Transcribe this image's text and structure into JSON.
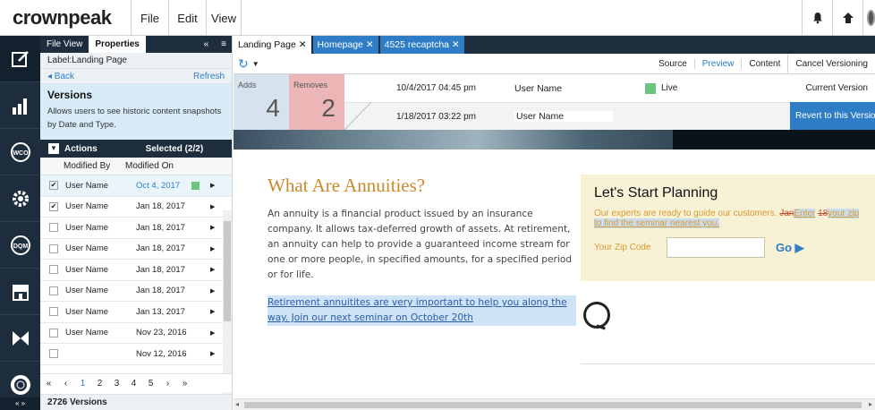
{
  "app": {
    "logo": "crownpeak"
  },
  "menu": {
    "file": "File",
    "edit": "Edit",
    "view": "View"
  },
  "panel": {
    "tab_file_view": "File View",
    "tab_properties": "Properties",
    "label": "Label:Landing Page",
    "back": "◂ Back",
    "refresh": "Refresh",
    "versions_title": "Versions",
    "versions_desc": "Allows users to see historic content snapshots by Date and Type.",
    "actions": "Actions",
    "selected": "Selected (2/2)",
    "col_modified_by": "Modified By",
    "col_modified_on": "Modified On",
    "rows": [
      {
        "user": "User Name",
        "date": "Oct 4, 2017",
        "checked": true
      },
      {
        "user": "User Name",
        "date": "Jan 18, 2017",
        "checked": true
      },
      {
        "user": "User Name",
        "date": "Jan 18, 2017",
        "checked": false
      },
      {
        "user": "User Name",
        "date": "Jan 18, 2017",
        "checked": false
      },
      {
        "user": "User Name",
        "date": "Jan 18, 2017",
        "checked": false
      },
      {
        "user": "User Name",
        "date": "Jan 18, 2017",
        "checked": false
      },
      {
        "user": "User Name",
        "date": "Jan 13, 2017",
        "checked": false
      },
      {
        "user": "User Name",
        "date": "Nov 23, 2016",
        "checked": false
      },
      {
        "user": "",
        "date": "Nov 12, 2016",
        "checked": false
      }
    ],
    "pager": {
      "first": "«",
      "prev": "‹",
      "pages": [
        "1",
        "2",
        "3",
        "4",
        "5"
      ],
      "next": "›",
      "last": "»"
    },
    "footer": "2726 Versions"
  },
  "tabs": [
    {
      "label": "Landing Page ✕"
    },
    {
      "label": "Homepage ✕"
    },
    {
      "label": "4525 recaptcha ✕"
    }
  ],
  "toolbar": {
    "source": "Source",
    "preview": "Preview",
    "content": "Content",
    "cancel": "Cancel Versioning"
  },
  "compare": {
    "adds_label": "Adds",
    "adds_count": "4",
    "removes_label": "Removes",
    "removes_count": "2",
    "v1_time": "10/4/2017 04:45 pm",
    "v1_user": "User Name",
    "v1_status": "Live",
    "v1_current": "Current Version",
    "v2_time": "1/18/2017 03:22 pm",
    "v2_user": "User Name",
    "revert": "Revert to this Version"
  },
  "preview": {
    "title": "What Are Annuities?",
    "body": "An annuity is a financial product issued by an insurance company. It allows tax-deferred growth of assets. At retirement, an annuity can help to provide a guaranteed income stream for one or more people, in specified amounts, for a specified period or for life.",
    "link": "Retirement annuitites are very important to help you along the way. Join our next seminar on October 20th",
    "planning_title": "Let's Start Planning",
    "planning_text": "Our experts are ready to guide our customers.",
    "planning_removed_1": "Jan",
    "planning_inserted_1": "Enter",
    "planning_removed_2": "18",
    "planning_inserted_2": "your zip to find the seminar nearest you.",
    "zip_label": "Your Zip Code",
    "go": "Go ▶"
  },
  "colors": {
    "nav_dark": "#1e2d3d",
    "accent": "#2e7dc6",
    "live": "#6cc57f",
    "title_gold": "#c98a2b"
  }
}
